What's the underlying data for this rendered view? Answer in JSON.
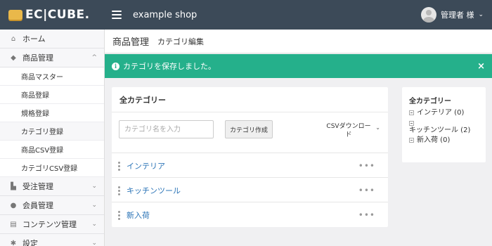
{
  "logo": {
    "text": "EC|CUBE."
  },
  "header": {
    "shop_name": "example shop",
    "user_label": "管理者 様",
    "user_caret": "⌄"
  },
  "sidebar": {
    "items": [
      {
        "label": "ホーム",
        "icon": "home-icon"
      },
      {
        "label": "商品管理",
        "icon": "tag-icon",
        "caret": "^"
      },
      {
        "label": "受注管理",
        "icon": "cart-icon",
        "caret": "⌄"
      },
      {
        "label": "会員管理",
        "icon": "users-icon",
        "caret": "⌄"
      },
      {
        "label": "コンテンツ管理",
        "icon": "file-icon",
        "caret": "⌄"
      },
      {
        "label": "設定",
        "icon": "gear-icon",
        "caret": "⌄"
      }
    ],
    "sub_items": [
      "商品マスター",
      "商品登録",
      "規格登録",
      "カテゴリ登録",
      "商品CSV登録",
      "カテゴリCSV登録"
    ]
  },
  "page": {
    "title": "商品管理",
    "subtitle": "カテゴリ編集"
  },
  "alert": {
    "message": "カテゴリを保存しました。",
    "close": "×"
  },
  "card": {
    "title": "全カテゴリー",
    "input_placeholder": "カテゴリ名を入力",
    "create_label": "カテゴリ作成",
    "csv_label": "CSVダウンロー\nド",
    "csv_caret": "⌄",
    "menu_label": "•••",
    "rows": [
      "インテリア",
      "キッチンツール",
      "新入荷"
    ]
  },
  "tree": {
    "title": "全カテゴリー",
    "items": [
      "インテリア (0)",
      "キッチンツール (2)",
      "新入荷 (0)"
    ]
  }
}
